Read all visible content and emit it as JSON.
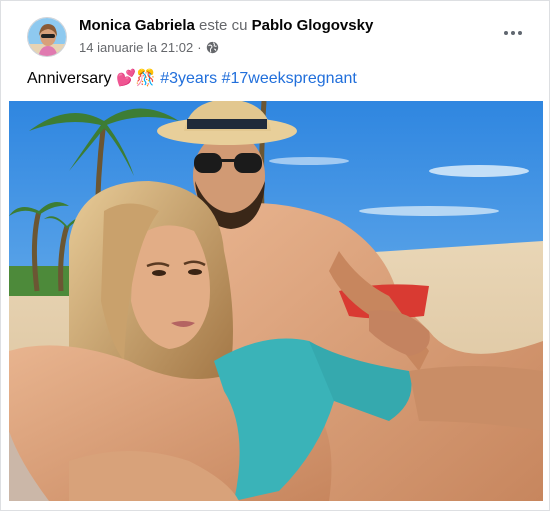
{
  "post": {
    "author": "Monica Gabriela",
    "linker": "este cu",
    "tagged_person": "Pablo Glogovsky",
    "timestamp": "14 ianuarie la 21:02",
    "separator": "·",
    "privacy_icon": "globe-icon",
    "more_icon": "more-options-icon",
    "caption": {
      "text": "Anniversary",
      "emojis": "💕🎊",
      "hashtags": [
        "#3years",
        "#17weekspregnant"
      ]
    },
    "photo_description_icon": "beach-selfie-photo"
  },
  "colors": {
    "hashtag": "#216fdb",
    "secondary_text": "#65676b",
    "primary_text": "#050505"
  }
}
